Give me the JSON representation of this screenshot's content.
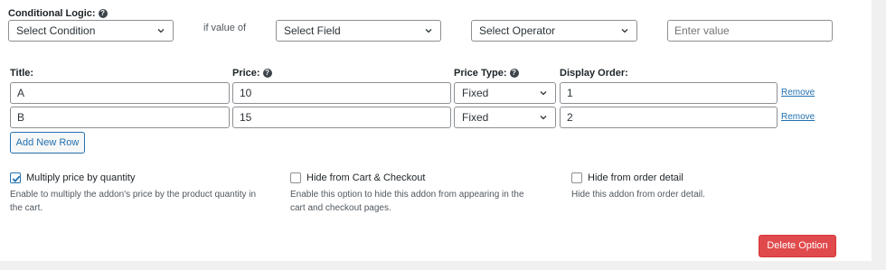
{
  "conditional": {
    "label": "Conditional Logic:",
    "help_icon": "question-circle-icon",
    "condition_select": "Select Condition",
    "if_value_of": "if value of",
    "field_select": "Select Field",
    "operator_select": "Select Operator",
    "value_placeholder": "Enter value"
  },
  "columns": {
    "title": "Title:",
    "price": "Price:",
    "price_type": "Price Type:",
    "display_order": "Display Order:"
  },
  "rows": [
    {
      "title": "A",
      "price": "10",
      "price_type": "Fixed",
      "display_order": "1",
      "remove": "Remove"
    },
    {
      "title": "B",
      "price": "15",
      "price_type": "Fixed",
      "display_order": "2",
      "remove": "Remove"
    }
  ],
  "add_row_label": "Add New Row",
  "options": [
    {
      "label": "Multiply price by quantity",
      "checked": true,
      "description_line1": "Enable to multiply the addon's price by the product quantity in",
      "description_line2": "the cart."
    },
    {
      "label": "Hide from Cart & Checkout",
      "checked": false,
      "description_line1": "Enable this option to hide this addon from appearing in the",
      "description_line2": "cart and checkout pages."
    },
    {
      "label": "Hide from order detail",
      "checked": false,
      "description_line1": "Hide this addon from order detail.",
      "description_line2": ""
    }
  ],
  "delete_label": "Delete Option",
  "colors": {
    "accent": "#2271b1",
    "danger": "#e04a4c",
    "page_bg": "#f0f0f1"
  }
}
